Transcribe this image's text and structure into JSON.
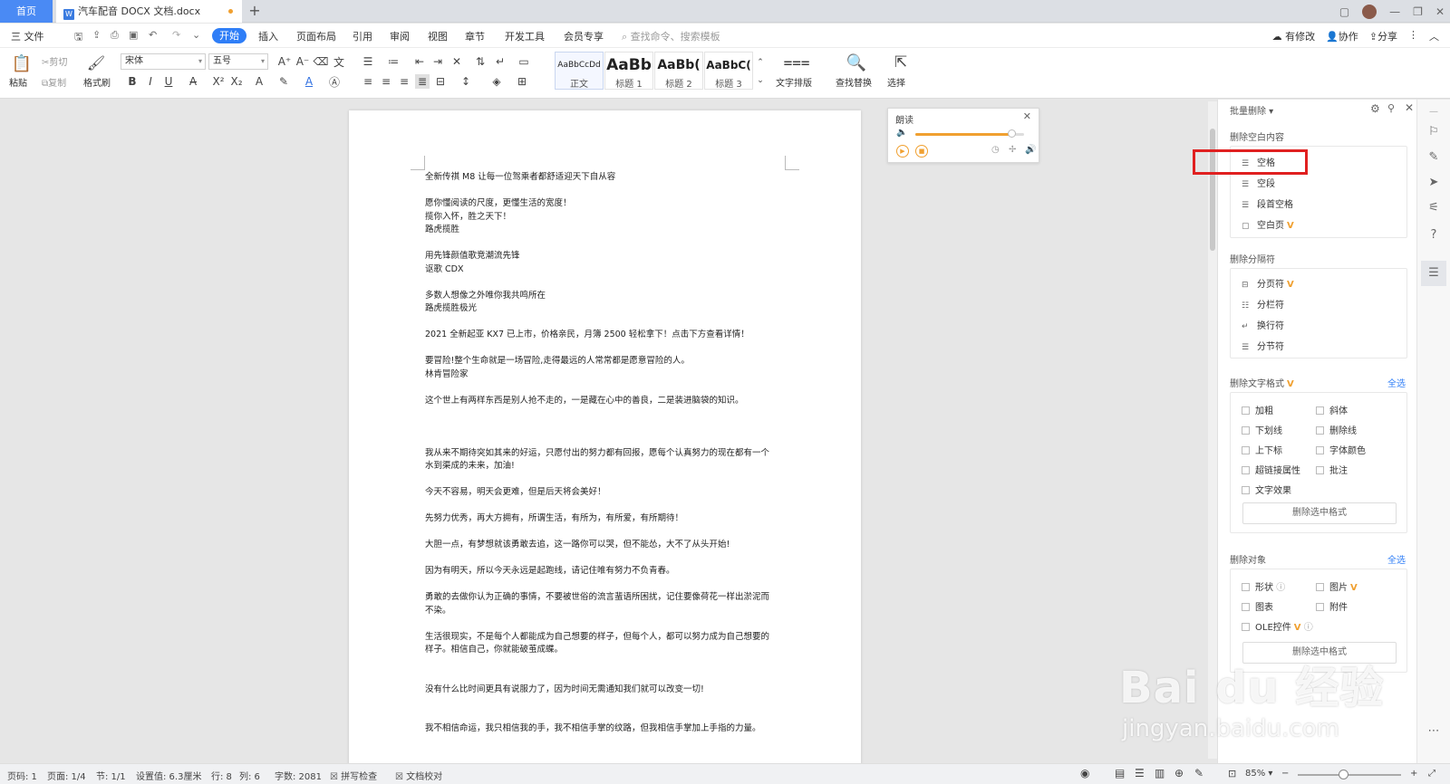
{
  "titlebar": {
    "home_tab": "首页",
    "doc_tab": "汽车配音 DOCX 文档.docx",
    "doc_icon": "W"
  },
  "menubar": {
    "file": "三 文件",
    "start": "开始",
    "items": [
      "插入",
      "页面布局",
      "引用",
      "审阅",
      "视图",
      "章节",
      "开发工具",
      "会员专享"
    ],
    "search_placeholder": "查找命令、搜索模板",
    "modified": "有修改",
    "collab": "协作",
    "share": "分享"
  },
  "ribbon": {
    "paste": "粘贴",
    "cut": "剪切",
    "copy": "复制",
    "format_painter": "格式刷",
    "font": "宋体",
    "size": "五号",
    "styles": [
      {
        "preview": "AaBbCcDd",
        "name": "正文"
      },
      {
        "preview": "AaBb",
        "name": "标题 1"
      },
      {
        "preview": "AaBb(",
        "name": "标题 2"
      },
      {
        "preview": "AaBbC(",
        "name": "标题 3"
      }
    ],
    "text_layout": "文字排版",
    "find_replace": "查找替换",
    "select": "选择"
  },
  "document": {
    "lines": [
      {
        "t": "全新传祺 M8 让每一位驾乘者都舒适迎天下自从容"
      },
      {
        "t": ""
      },
      {
        "t": "愿你懂阅读的尺度，更懂生活的宽度！"
      },
      {
        "t": "揽你入怀，胜之天下！"
      },
      {
        "t": "路虎揽胜"
      },
      {
        "t": ""
      },
      {
        "t": "用先锋颜值歌竞潮流先锋"
      },
      {
        "t": "讴歌 CDX"
      },
      {
        "t": ""
      },
      {
        "t": "多数人想像之外唯你我共鸣所在"
      },
      {
        "t": "路虎揽胜极光"
      },
      {
        "t": ""
      },
      {
        "t": "2021 全新起亚 KX7 已上市，价格亲民，月簿 2500 轻松拿下！点击下方查看详情！"
      },
      {
        "t": ""
      },
      {
        "t": "要冒险!整个生命就是一场冒险,走得最远的人常常都是愿意冒险的人。"
      },
      {
        "t": "林肯冒险家"
      },
      {
        "t": ""
      },
      {
        "t": "这个世上有两样东西是别人抢不走的，一是藏在心中的善良，二是装进脑袋的知识。"
      },
      {
        "t": ""
      },
      {
        "t": ""
      },
      {
        "t": ""
      },
      {
        "t": "我从来不期待突如其来的好运，只愿付出的努力都有回报，愿每个认真努力的现在都有一个"
      },
      {
        "t": "水到渠成的未来，加油!"
      },
      {
        "t": ""
      },
      {
        "t": "今天不容易，明天会更难，但是后天将会美好！"
      },
      {
        "t": ""
      },
      {
        "t": "先努力优秀，再大方拥有，所谓生活，有所为，有所爱，有所期待！"
      },
      {
        "t": ""
      },
      {
        "t": "大胆一点，有梦想就该勇敢去追，这一路你可以哭，但不能怂，大不了从头开始!"
      },
      {
        "t": ""
      },
      {
        "t": "因为有明天，所以今天永远是起跑线，请记住唯有努力不负青春。"
      },
      {
        "t": ""
      },
      {
        "t": "勇敢的去做你认为正确的事情，不要被世俗的流言蜚语所困扰，记住要像荷花一样出淤泥而"
      },
      {
        "t": "不染。"
      },
      {
        "t": ""
      },
      {
        "t": "生活很现实，不是每个人都能成为自己想要的样子，但每个人，都可以努力成为自己想要的"
      },
      {
        "t": "样子。相信自己，你就能破茧成蝶。"
      },
      {
        "t": ""
      },
      {
        "t": ""
      },
      {
        "t": "没有什么比时间更具有说服力了，因为时间无需通知我们就可以改变一切!"
      },
      {
        "t": ""
      },
      {
        "t": ""
      },
      {
        "t": "我不相信命运，我只相信我的手，我不相信手掌的纹路，但我相信手掌加上手指的力量。"
      }
    ]
  },
  "reader": {
    "title": "朗读",
    "volume": 0.88
  },
  "pane": {
    "title": "批量删除",
    "section_blank": "删除空白内容",
    "blank_items": [
      {
        "label": "空格",
        "vip": false
      },
      {
        "label": "空段",
        "vip": false
      },
      {
        "label": "段首空格",
        "vip": false
      },
      {
        "label": "空白页",
        "vip": true
      }
    ],
    "section_sep": "删除分隔符",
    "sep_items": [
      {
        "label": "分页符",
        "vip": true
      },
      {
        "label": "分栏符",
        "vip": false
      },
      {
        "label": "换行符",
        "vip": false
      },
      {
        "label": "分节符",
        "vip": false
      }
    ],
    "section_fmt": "删除文字格式",
    "select_all": "全选",
    "fmt_left": [
      "加粗",
      "下划线",
      "上下标",
      "超链接属性",
      "文字效果"
    ],
    "fmt_right": [
      "斜体",
      "删除线",
      "字体颜色",
      "批注"
    ],
    "del_fmt_btn": "删除选中格式",
    "section_obj": "删除对象",
    "obj_left": [
      "形状",
      "图表",
      "OLE控件"
    ],
    "obj_right": [
      "图片",
      "附件"
    ],
    "del_obj_btn": "删除选中格式",
    "vip_mark": "V"
  },
  "statusbar": {
    "page": "页码: 1",
    "pages": "页面: 1/4",
    "section": "节: 1/1",
    "setting": "设置值: 6.3厘米",
    "row": "行: 8",
    "col": "列: 6",
    "words": "字数: 2081",
    "spell": "拼写检查",
    "proof": "文档校对",
    "zoom": "85%"
  },
  "watermark": {
    "main": "Bai du 经验",
    "url": "jingyan.baidu.com"
  },
  "colors": {
    "accent": "#2f7ef7",
    "highlight": "#e02020",
    "vip": "#f0a030"
  }
}
